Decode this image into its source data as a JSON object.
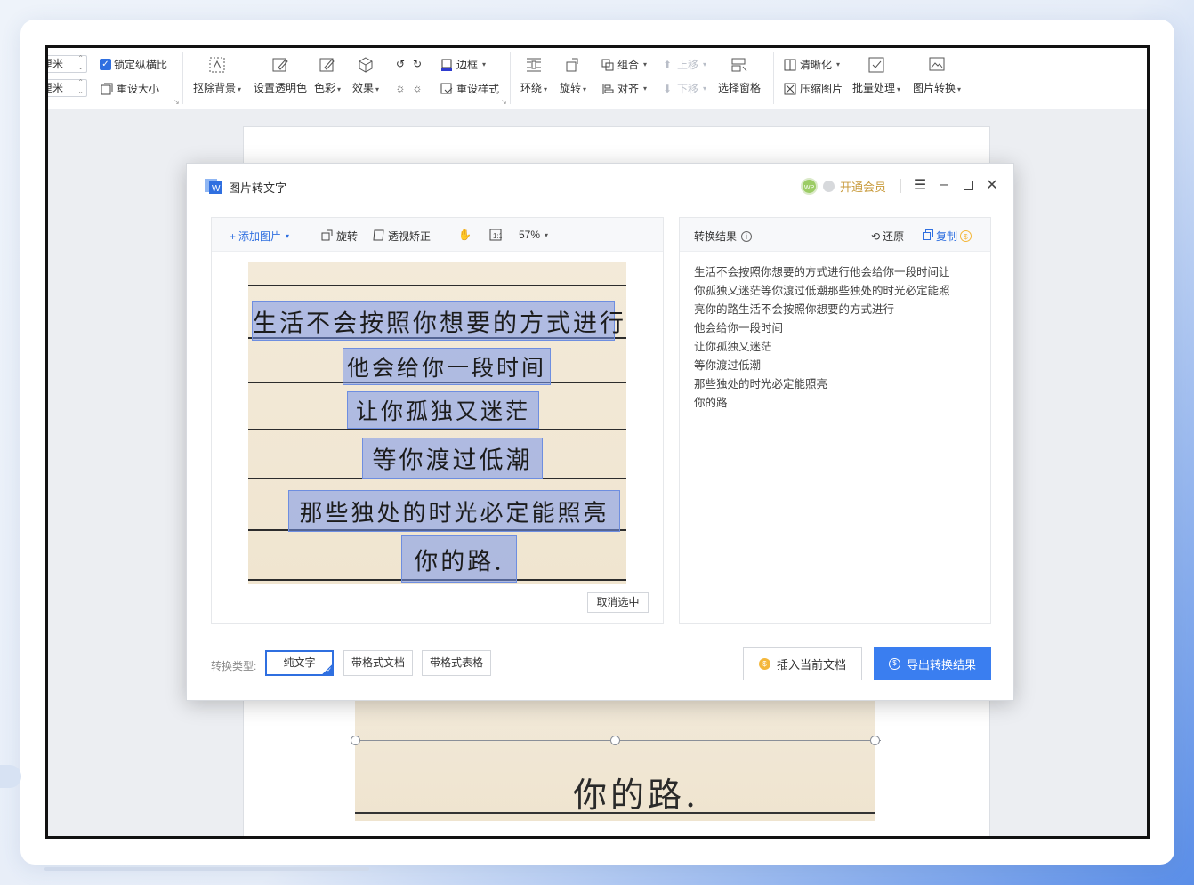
{
  "ribbon": {
    "spin_unit_1": "厘米",
    "spin_unit_2": "厘米",
    "lock_ratio": "锁定纵横比",
    "reset_size": "重设大小",
    "remove_bg": "抠除背景",
    "set_transparent": "设置透明色",
    "color": "色彩",
    "effects": "效果",
    "border": "边框",
    "reset_style": "重设样式",
    "wrap": "环绕",
    "rotate": "旋转",
    "group": "组合",
    "align": "对齐",
    "move_up": "上移",
    "move_down": "下移",
    "selection_pane": "选择窗格",
    "sharpen": "清晰化",
    "compress": "压缩图片",
    "batch": "批量处理",
    "convert": "图片转换"
  },
  "dialog": {
    "title": "图片转文字",
    "avatar_text": "WP",
    "vip": "开通会员",
    "toolbar": {
      "add_image": "添加图片",
      "rotate": "旋转",
      "perspective": "透视矫正",
      "zoom": "57%"
    },
    "image_lines": [
      "生活不会按照你想要的方式进行",
      "他会给你一段时间",
      "让你孤独又迷茫",
      "等你渡过低潮",
      "那些独处的时光必定能照亮",
      "你的路."
    ],
    "cancel_selection": "取消选中",
    "result_title": "转换结果",
    "restore": "还原",
    "copy": "复制",
    "result_lines": [
      "生活不会按照你想要的方式进行他会给你一段时间让",
      "你孤独又迷茫等你渡过低潮那些独处的时光必定能照",
      "亮你的路生活不会按照你想要的方式进行",
      "他会给你一段时间",
      "让你孤独又迷茫",
      "等你渡过低潮",
      "那些独处的时光必定能照亮",
      "你的路"
    ],
    "convert_type_label": "转换类型:",
    "types": [
      "纯文字",
      "带格式文档",
      "带格式表格"
    ],
    "insert_btn": "插入当前文档",
    "export_btn": "导出转换结果"
  },
  "document": {
    "image_text": "你的路."
  },
  "colors": {
    "accent": "#3a7ef0",
    "vip_gold": "#c89a3b",
    "highlight": "#7896eb"
  }
}
